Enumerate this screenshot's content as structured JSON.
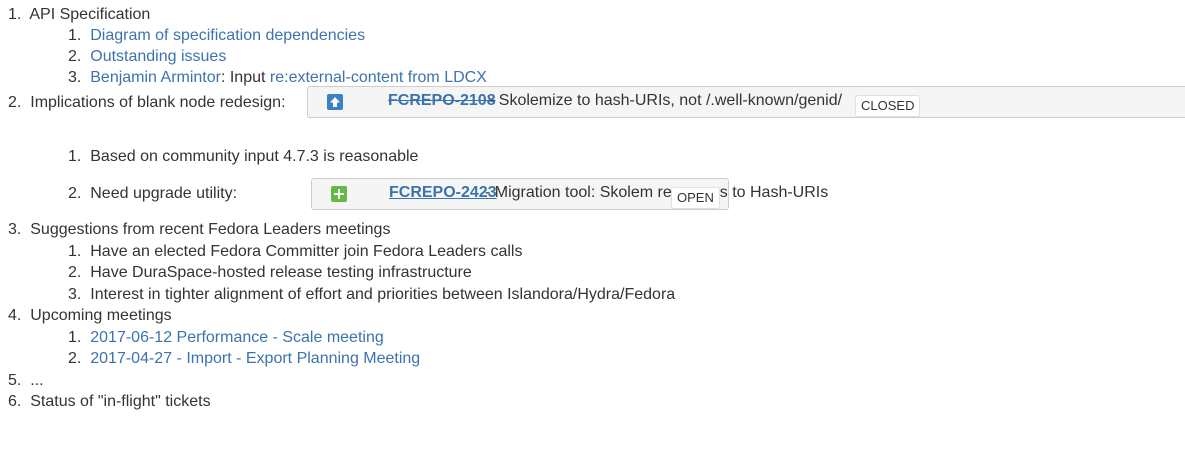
{
  "items": [
    {
      "num": "1.",
      "text": "API Specification",
      "sub": [
        {
          "num": "1.",
          "link": "Diagram of specification dependencies"
        },
        {
          "num": "2.",
          "link": "Outstanding issues"
        },
        {
          "num": "3.",
          "link": "Benjamin Armintor",
          "text": ": Input ",
          "link2": "re:external-content from LDCX"
        }
      ]
    },
    {
      "num": "2.",
      "text": "Implications of blank node redesign:",
      "jira": {
        "key": "FCREPO-2108",
        "summary": " - Skolemize to hash-URIs, not /.well-known/genid/",
        "status": "CLOSED",
        "icon": "improvement-icon",
        "icon_color": "#3b7fc4"
      },
      "sub": [
        {
          "num": "1.",
          "text": "Based on community input 4.7.3 is reasonable"
        },
        {
          "num": "2.",
          "text": "Need upgrade utility:",
          "jira": {
            "key": "FCREPO-2423",
            "summary": " - Migration tool: Skolem resources to Hash-URIs",
            "status": "OPEN",
            "icon": "new-feature-icon",
            "icon_color": "#65ba43"
          }
        }
      ]
    },
    {
      "num": "3.",
      "text": "Suggestions from recent Fedora Leaders meetings",
      "sub": [
        {
          "num": "1.",
          "text": "Have an elected Fedora Committer join Fedora Leaders calls"
        },
        {
          "num": "2.",
          "text": "Have DuraSpace-hosted release testing infrastructure"
        },
        {
          "num": "3.",
          "text": "Interest in tighter alignment of effort and priorities between Islandora/Hydra/Fedora"
        }
      ]
    },
    {
      "num": "4.",
      "text": "Upcoming meetings",
      "sub": [
        {
          "num": "1.",
          "link": "2017-06-12 Performance - Scale meeting"
        },
        {
          "num": "2.",
          "link": "2017-04-27 - Import - Export Planning Meeting"
        }
      ]
    },
    {
      "num": "5.",
      "text": "..."
    },
    {
      "num": "6.",
      "text": "Status of \"in-flight\" tickets"
    }
  ],
  "colors": {
    "link": "#3b73af",
    "text": "#333333"
  }
}
